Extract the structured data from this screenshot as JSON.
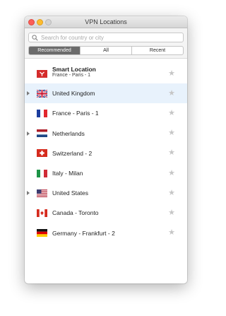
{
  "window": {
    "title": "VPN Locations"
  },
  "search": {
    "placeholder": "Search for country or city",
    "value": ""
  },
  "tabs": [
    {
      "label": "Recommended",
      "active": true
    },
    {
      "label": "All",
      "active": false
    },
    {
      "label": "Recent",
      "active": false
    }
  ],
  "locations": [
    {
      "label": "Smart Location",
      "sublabel": "France - Paris - 1",
      "flag": "smart-location-icon",
      "expandable": false,
      "selected": false
    },
    {
      "label": "United Kingdom",
      "flag": "uk-flag-icon",
      "expandable": true,
      "selected": true
    },
    {
      "label": "France - Paris - 1",
      "flag": "france-flag-icon",
      "expandable": false,
      "selected": false
    },
    {
      "label": "Netherlands",
      "flag": "netherlands-flag-icon",
      "expandable": true,
      "selected": false
    },
    {
      "label": "Switzerland - 2",
      "flag": "switzerland-flag-icon",
      "expandable": false,
      "selected": false
    },
    {
      "label": "Italy - Milan",
      "flag": "italy-flag-icon",
      "expandable": false,
      "selected": false
    },
    {
      "label": "United States",
      "flag": "us-flag-icon",
      "expandable": true,
      "selected": false
    },
    {
      "label": "Canada - Toronto",
      "flag": "canada-flag-icon",
      "expandable": false,
      "selected": false
    },
    {
      "label": "Germany - Frankfurt - 2",
      "flag": "germany-flag-icon",
      "expandable": false,
      "selected": false
    }
  ],
  "colors": {
    "selected_row": "#e8f2fc",
    "active_tab": "#6b6b6b",
    "star": "#c6c6c6"
  }
}
